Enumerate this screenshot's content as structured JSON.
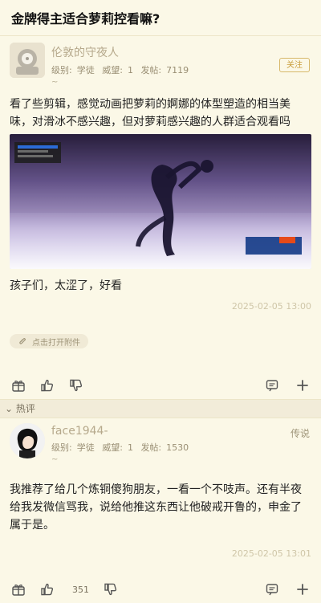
{
  "header": {
    "title": "金牌得主适合萝莉控看嘛?"
  },
  "post": {
    "author": {
      "name": "伦敦的守夜人",
      "level_label": "级别:",
      "level_value": "学徒",
      "reputation_label": "威望:",
      "reputation_value": "1",
      "posts_label": "发帖:",
      "posts_value": "7119",
      "subline": "~"
    },
    "follow_label": "关注",
    "text": "看了些剪辑，感觉动画把萝莉的婀娜的体型塑造的相当美味，对滑冰不感兴趣，但对萝莉感兴趣的人群适合观看吗",
    "image_alt_icon": "image-figure-skating",
    "caption": "孩子们，太涩了，好看",
    "timestamp": "2025-02-05 13:00",
    "attachment_label": "点击打开附件"
  },
  "section": {
    "hot_label": "热评"
  },
  "comment": {
    "author": {
      "name": "face1944-",
      "level_label": "级别:",
      "level_value": "学徒",
      "reputation_label": "威望:",
      "reputation_value": "1",
      "posts_label": "发帖:",
      "posts_value": "1530"
    },
    "tag": "传说",
    "text": "我推荐了给几个炼铜傻狗朋友，一看一个不吱声。还有半夜给我发微信骂我，说给他推这东西让他破戒开鲁的，申金了属于是。",
    "timestamp": "2025-02-05 13:01",
    "like_count": "351"
  },
  "colors": {
    "background": "#fbf8e7",
    "accent": "#c89d39",
    "muted": "#9f9579"
  }
}
